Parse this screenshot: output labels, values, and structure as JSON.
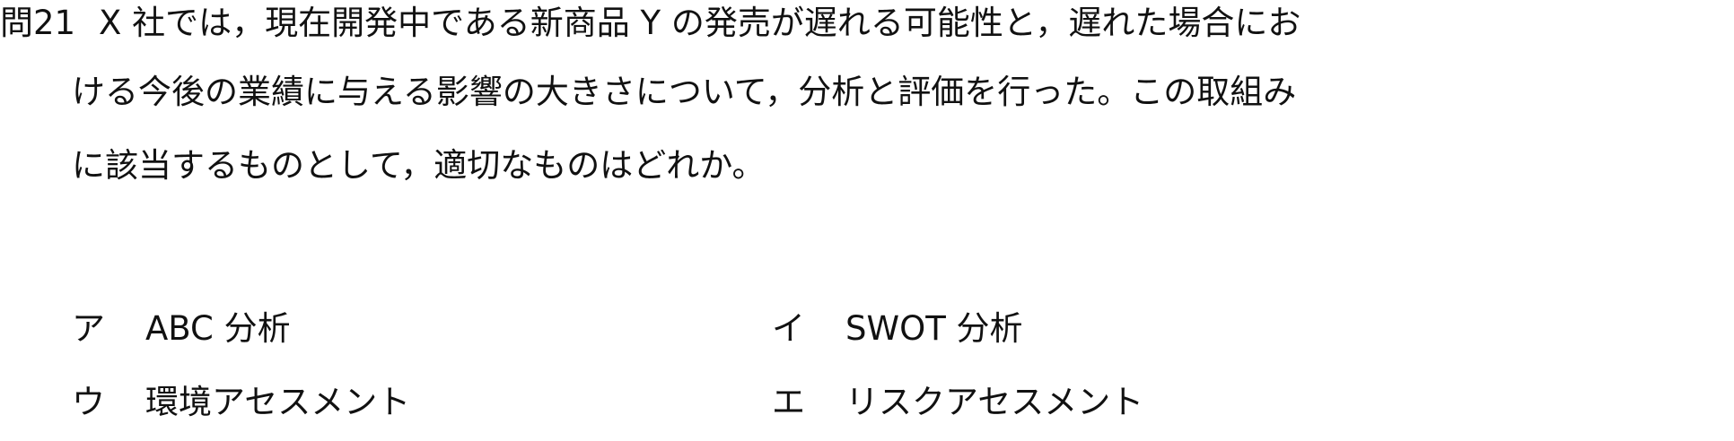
{
  "question": {
    "number": "問21",
    "lines": [
      "X 社では，現在開発中である新商品 Y の発売が遅れる可能性と，遅れた場合にお",
      "ける今後の業績に与える影響の大きさについて，分析と評価を行った。この取組み",
      "に該当するものとして，適切なものはどれか。"
    ]
  },
  "choices": [
    {
      "mark": "ア",
      "text": "ABC 分析"
    },
    {
      "mark": "イ",
      "text": "SWOT 分析"
    },
    {
      "mark": "ウ",
      "text": "環境アセスメント"
    },
    {
      "mark": "エ",
      "text": "リスクアセスメント"
    }
  ]
}
